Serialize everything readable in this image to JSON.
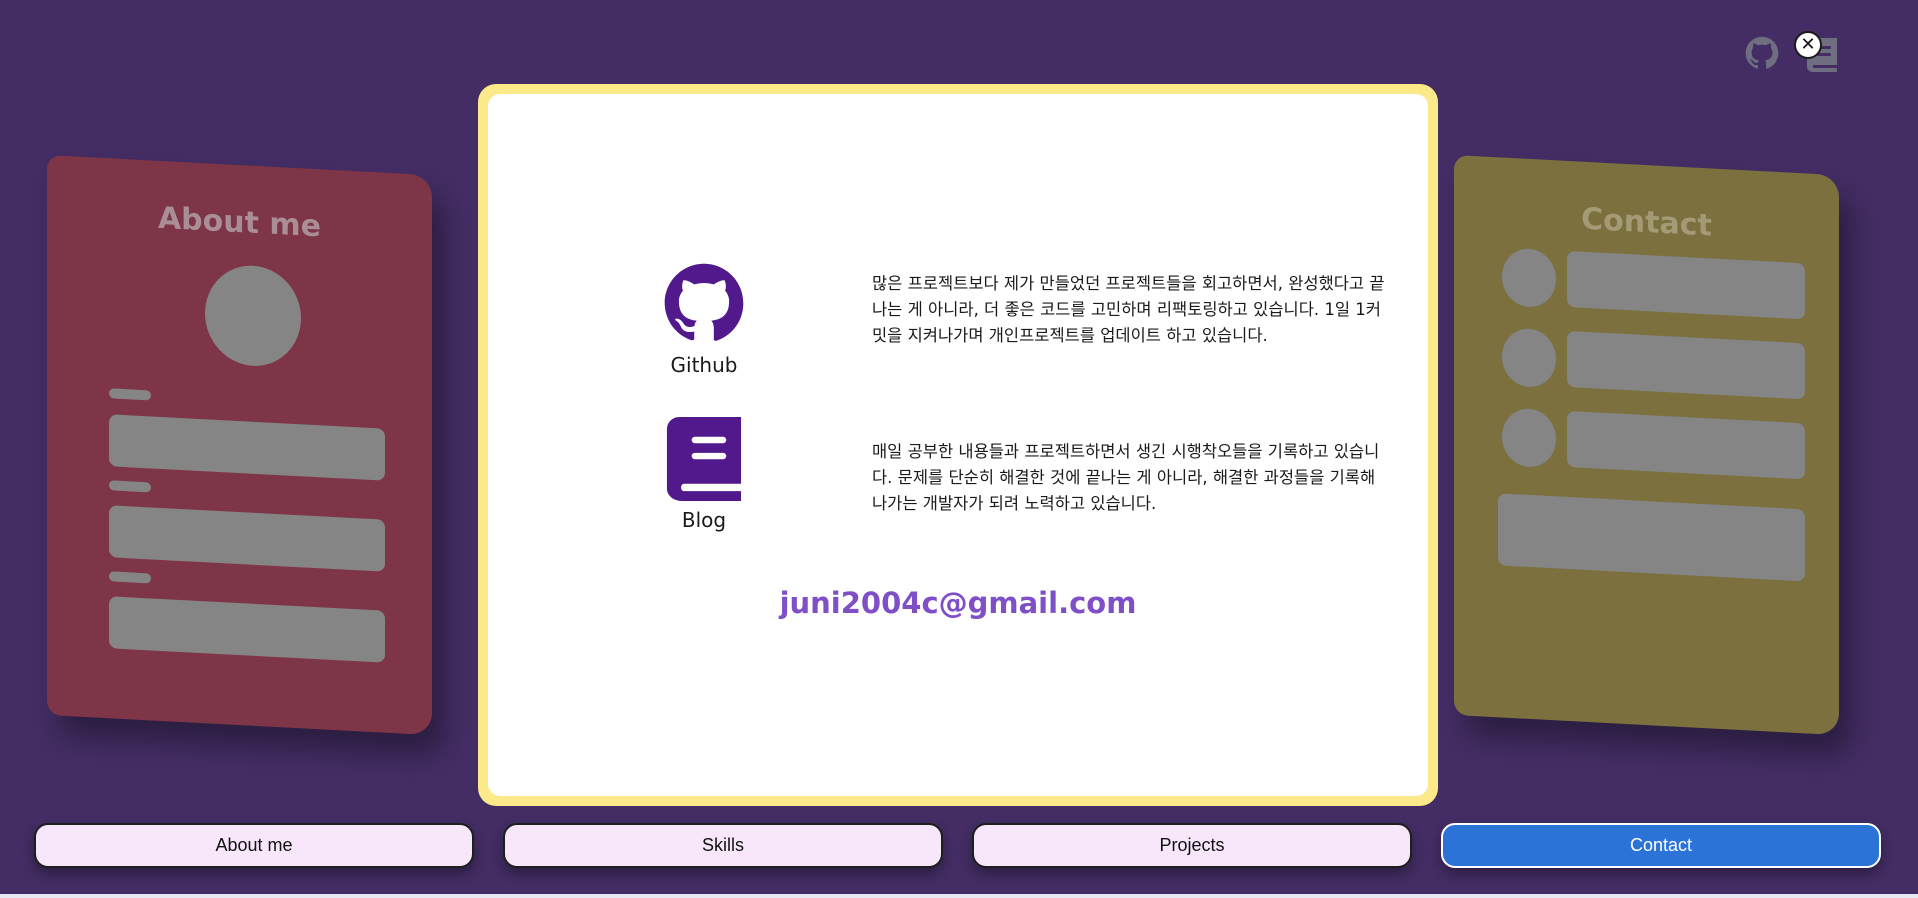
{
  "colors": {
    "background": "#432d64",
    "modal_border": "#fbe98a",
    "email": "#7f4fc8",
    "icon_purple": "#52198d",
    "active_button": "#2b73d6",
    "inactive_button": "#f8e6fb"
  },
  "top_icons": {
    "github_icon": "github-icon",
    "book_icon": "book-icon",
    "close_symbol": "✕"
  },
  "side_cards": {
    "left_title": "About me",
    "right_title": "Contact"
  },
  "modal": {
    "entries": [
      {
        "icon": "github-icon",
        "label": "Github",
        "description": "많은 프로젝트보다 제가 만들었던 프로젝트들을 회고하면서, 완성했다고 끝나는 게 아니라, 더 좋은 코드를 고민하며 리팩토링하고 있습니다. 1일 1커밋을 지켜나가며 개인프로젝트를 업데이트 하고 있습니다."
      },
      {
        "icon": "book-icon",
        "label": "Blog",
        "description": "매일 공부한 내용들과 프로젝트하면서 생긴 시행착오들을 기록하고 있습니다. 문제를 단순히 해결한 것에 끝나는 게 아니라, 해결한 과정들을 기록해 나가는 개발자가 되려 노력하고 있습니다."
      }
    ],
    "email": "juni2004c@gmail.com"
  },
  "nav": {
    "items": [
      {
        "label": "About me",
        "active": false
      },
      {
        "label": "Skills",
        "active": false
      },
      {
        "label": "Projects",
        "active": false
      },
      {
        "label": "Contact",
        "active": true
      }
    ]
  }
}
